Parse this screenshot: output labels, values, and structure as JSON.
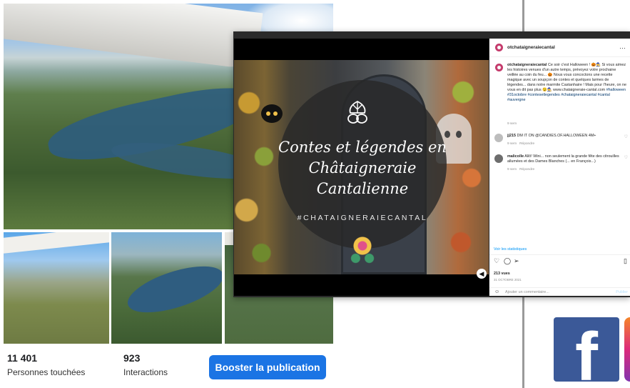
{
  "facebook_post": {
    "stats": [
      {
        "value": "11 401",
        "label": "Personnes touchées"
      },
      {
        "value": "923",
        "label": "Interactions"
      }
    ],
    "boost_label": "Booster la publication",
    "accent_color": "#1b74e4"
  },
  "instagram_post": {
    "username": "otchataigneraiecantal",
    "more_icon": "…",
    "image_title": "Contes et légendes en Châtaigneraie Cantalienne",
    "image_hashtag": "#CHATAIGNERAIECANTAL",
    "caption": {
      "author": "otchataigneraiecantal",
      "text": "Ce soir c'est Halloween ! 🎃🧙 Si vous aimez les histoires venues d'un autre temps, prévoyez votre prochaine veillée au coin du feu... 🎃 Nous vous concoctons une recette magique avec un soupçon de contes et quelques larmes de légendes... dans notre marmite Castanhaire ! Mais pour l'heure, on ne vous en dit pas plus 😉🧙 www.chataigneraie-cantal.com",
      "tags": "#halloween #31octobre #contesetlegendes #chataigneraiecantal #cantal #auvergne",
      "time": "9 sem"
    },
    "comments": [
      {
        "author": "jj215",
        "text": "DM IT ON @CANDIES.OF.HALLOWEEN 4M+",
        "time": "9 sem",
        "reply": "Répondre"
      },
      {
        "author": "malicolle",
        "text": "Allô! Wini... non seulement la grande fête des citrouilles allumées et des Dames Blanches (... en François...)",
        "time": "9 sem",
        "reply": "Répondre"
      }
    ],
    "stats_link": "Voir les statistiques",
    "views": "213 vues",
    "date": "31 OCTOBRE 2021",
    "comment_placeholder": "Ajouter un commentaire...",
    "publish_label": "Publier"
  },
  "logos": {
    "facebook_letter": "f",
    "facebook_color": "#3b5998"
  }
}
